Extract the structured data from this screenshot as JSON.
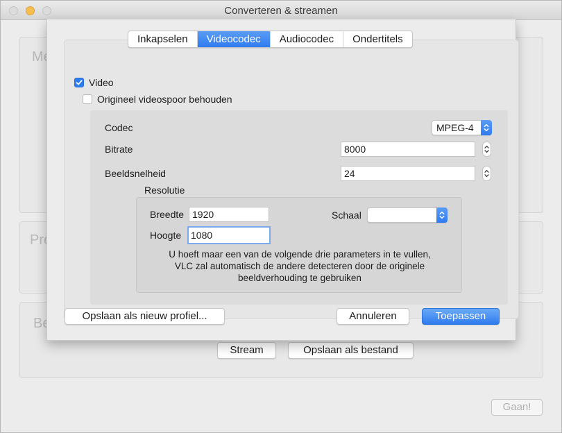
{
  "window": {
    "title": "Converteren & streamen",
    "background_labels": [
      "Me",
      "Pro",
      "Be"
    ],
    "stream_button": "Stream",
    "save_file_button": "Opslaan als bestand",
    "go_button": "Gaan!"
  },
  "tabs": [
    "Inkapselen",
    "Videocodec",
    "Audiocodec",
    "Ondertitels"
  ],
  "active_tab": "Videocodec",
  "video": {
    "video_checkbox_label": "Video",
    "video_checked": true,
    "keep_original_label": "Origineel videospoor behouden",
    "keep_original_checked": false,
    "codec_label": "Codec",
    "codec_value": "MPEG-4",
    "bitrate_label": "Bitrate",
    "bitrate_value": "8000",
    "framerate_label": "Beeldsnelheid",
    "framerate_value": "24",
    "resolution_label": "Resolutie",
    "width_label": "Breedte",
    "width_value": "1920",
    "height_label": "Hoogte",
    "height_value": "1080",
    "scale_label": "Schaal",
    "scale_value": "",
    "note_lines": [
      "U hoeft maar een van de volgende drie parameters in te vullen,",
      "VLC zal automatisch de andere detecteren door de originele",
      "beeldverhouding te gebruiken"
    ]
  },
  "footer": {
    "save_profile": "Opslaan als nieuw profiel...",
    "cancel": "Annuleren",
    "apply": "Toepassen"
  },
  "colors": {
    "accent": "#2f7cf0",
    "focus_ring": "#7aa9ee"
  }
}
